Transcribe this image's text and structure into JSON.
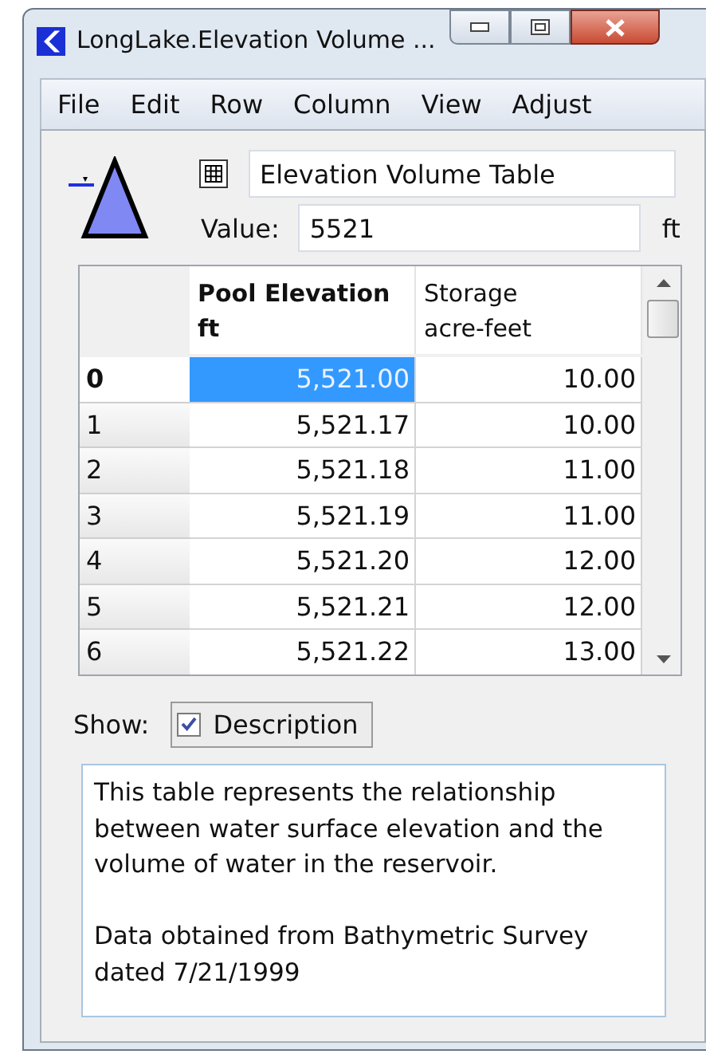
{
  "window": {
    "title": "LongLake.Elevation Volume ..."
  },
  "menu": [
    "File",
    "Edit",
    "Row",
    "Column",
    "View",
    "Adjust"
  ],
  "slot": {
    "name": "Elevation Volume Table",
    "value_label": "Value:",
    "value": "5521",
    "unit": "ft"
  },
  "table": {
    "columns": [
      {
        "label": "Pool Elevation",
        "unit": "ft",
        "bold": true
      },
      {
        "label": "Storage",
        "unit": "acre-feet",
        "bold": false
      }
    ],
    "rows": [
      {
        "index": "0",
        "selected": true,
        "cells": [
          "5,521.00",
          "10.00"
        ]
      },
      {
        "index": "1",
        "selected": false,
        "cells": [
          "5,521.17",
          "10.00"
        ]
      },
      {
        "index": "2",
        "selected": false,
        "cells": [
          "5,521.18",
          "11.00"
        ]
      },
      {
        "index": "3",
        "selected": false,
        "cells": [
          "5,521.19",
          "11.00"
        ]
      },
      {
        "index": "4",
        "selected": false,
        "cells": [
          "5,521.20",
          "12.00"
        ]
      },
      {
        "index": "5",
        "selected": false,
        "cells": [
          "5,521.21",
          "12.00"
        ]
      },
      {
        "index": "6",
        "selected": false,
        "cells": [
          "5,521.22",
          "13.00"
        ]
      }
    ]
  },
  "show": {
    "label": "Show:",
    "option": "Description",
    "checked": true
  },
  "description": {
    "paragraphs": [
      "This table represents the relationship between water surface elevation and the volume of water in the reservoir.",
      "Data obtained from Bathymetric Survey dated 7/21/1999"
    ]
  }
}
